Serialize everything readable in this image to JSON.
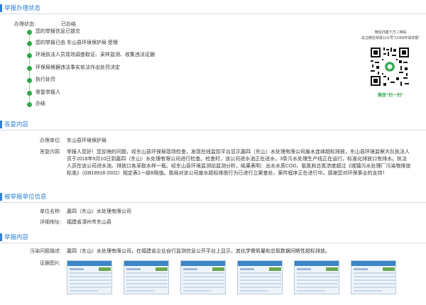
{
  "status_section": {
    "title": "举报办理状态",
    "status_label": "办理状态:",
    "status_value": "已办结",
    "steps": [
      "您的举报信息已提交",
      "您的举报已由 东山县环境保护局 受理",
      "环境执法人员现场调查取证、采样监测、收集违法证据",
      "环保局根据违法事实依法作出处罚决定",
      "执行处罚",
      "答复举报人",
      "办结"
    ],
    "qr": {
      "caption_line1": "微信扫描下方二维码",
      "caption_line2": "关注微信举报公众号“12369环保举报”",
      "scan_label": "微信“扫一扫”"
    }
  },
  "reply_section": {
    "title": "答复内容",
    "unit_label": "办理单位:",
    "unit_value": "东山县环境保护局",
    "content_label": "答复内容:",
    "content_value": "举报人您好！您反映的问题，经东山县环保局现场检查，发现在线监控平台显示嘉四（东山）水处理有限公司废水连续超标排放，东山县环境监察大队执法人员于2018年9月10日到嘉四（东山）水处理有限公司进行检查。检查时，该公司进水池正在进水，3条污水处理生产线正在运行，标准化排放口有排水。执法人员在该公司进水池、排放口各采取水样一瓶。经东山县环境监测站监测分析，结果表明：出水水质COD、氨氮和总氮浓度超过《城镇污水处理厂污染物排放标准》（GB18918-2002）规定表1一级B限值。我局对该公司废水超标排放行为已进行立案查处，案件程序正在进行中。感谢您对环保事业的支持！"
  },
  "reported_section": {
    "title": "被举报单位信息",
    "name_label": "单位名称:",
    "name_value": "嘉四（东山）水处理有限公司",
    "address_label": "详细地址:",
    "address_value": "福建省漳州市东山县"
  },
  "report_section": {
    "title": "举报内容",
    "problem_label": "污染问题描述:",
    "problem_value": "嘉四（东山）水处理有限公司，在福建省企业自行监测信息公开平台上显示，其化学需氧量和总氮数据间断性超标排放。",
    "evidence_label": "证据图片:"
  },
  "colors": {
    "accent": "#2f7fd6",
    "step_dot": "#2fa84f"
  }
}
